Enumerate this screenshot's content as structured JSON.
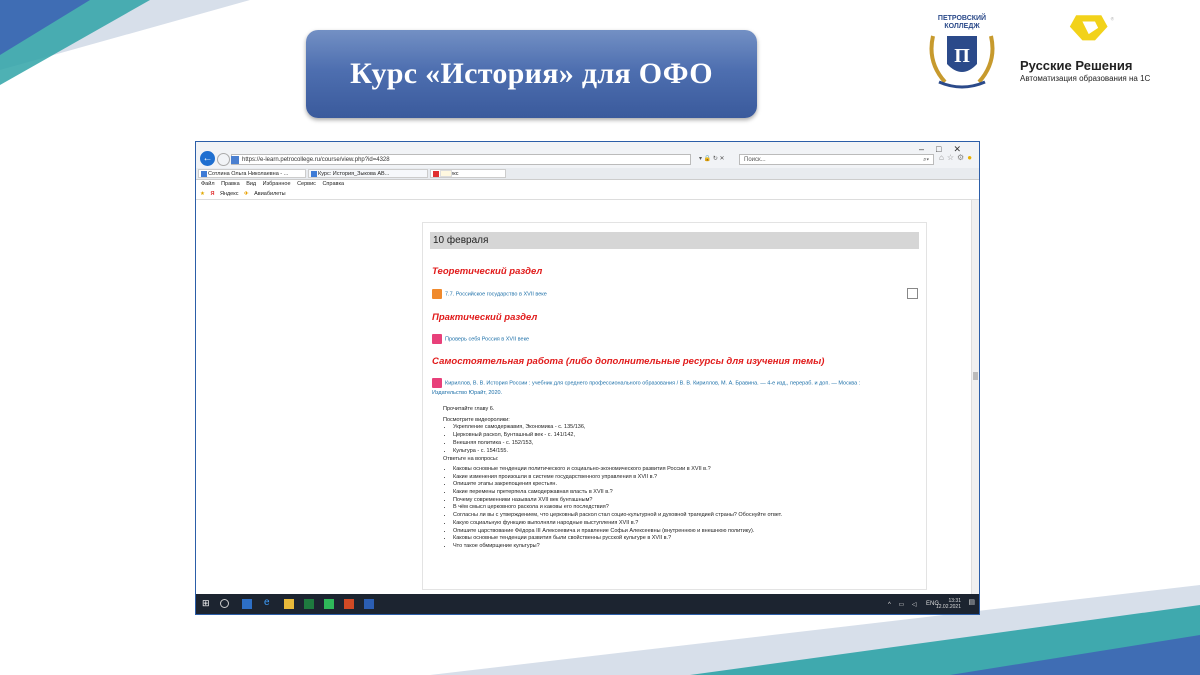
{
  "slide": {
    "title": "Курс «История» для ОФО",
    "logo_left": "ПЕТРОВСКИЙ КОЛЛЕДЖ",
    "logo_right_name": "Русские Решения",
    "logo_right_sub": "Автоматизация образования на 1С"
  },
  "browser": {
    "url": "https://e-learn.petrocollege.ru/course/view.php?id=4328",
    "search_placeholder": "Поиск...",
    "tabs": [
      {
        "label": "Сотлина Ольга Николаевна - ..."
      },
      {
        "label": "Курс: История_Зыкова АВ..."
      },
      {
        "label": "Яндекс"
      }
    ],
    "menu": [
      "Файл",
      "Правка",
      "Вид",
      "Избранное",
      "Сервис",
      "Справка"
    ],
    "favorites": [
      "Яндекс",
      "Авиабилеты"
    ]
  },
  "course": {
    "date": "10 февраля",
    "section_theory": "Теоретический раздел",
    "activity_theory": "7.7. Российское государство в XVII веке",
    "section_practice": "Практический раздел",
    "activity_practice": "Проверь себя Россия в XVII веке",
    "section_self": "Самостоятельная работа (либо дополнительные ресурсы для изучения темы)",
    "activity_self_1": "Кириллов, В. В. История России : учебник для среднего профессионального образования / В. В. Кириллов, М. А. Бравина. — 4-е изд., перераб. и доп. — Москва :",
    "activity_self_2": "Издательство Юрайт, 2020.",
    "read": "Прочитайте главу 6.",
    "watch": "Посмотрите видеоролики:",
    "videos": [
      "Укрепление самодержавия, Экономика - с. 135/136,",
      "Церковный раскол, Бунташный век - с. 141/142,",
      "Внешняя политика - с. 152/153,",
      "Культура - с. 154/155."
    ],
    "answer": "Ответьте на вопросы:",
    "questions": [
      "Каковы основные тенденции политического и социально-экономического развития России в XVII в.?",
      "Какие изменения произошли в системе государственного управления в XVII в.?",
      "Опишите этапы закрепощения крестьян.",
      "Какие перемены претерпела самодержавная власть в XVII в.?",
      "Почему современники называли XVII век бунташным?",
      "В чём смысл церковного раскола и каковы его последствия?",
      "Согласны ли вы с утверждением, что церковный раскол стал социо-культурной и духовной трагедией страны? Обоснуйте ответ.",
      "Какую социальную функцию выполняли народные выступления XVII в.?",
      "Опишите царствование Фёдора III Алексеевича и правление Софьи Алексеевны (внутреннюю и внешнюю политику).",
      "Каковы основные тенденции развития были свойственны русской культуре в XVII в.?",
      "Что такое обмирщение культуры?"
    ]
  },
  "taskbar": {
    "lang": "ENG",
    "time": "13:31",
    "date": "12.02.2021"
  },
  "colors": {
    "banner": "#4e6fb0",
    "section_red": "#e11b1b",
    "link": "#1c6fa8",
    "deco_teal": "#2fa3a7",
    "deco_blue": "#3f6db4"
  }
}
